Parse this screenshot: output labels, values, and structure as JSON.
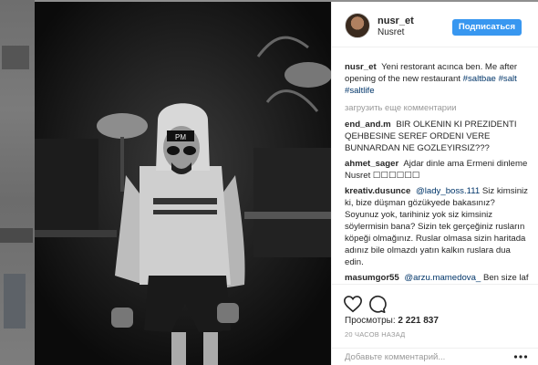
{
  "post": {
    "username": "nusr_et",
    "full_name": "Nusret",
    "follow_label": "Подписаться",
    "caption_user": "nusr_et",
    "caption_text": "Yeni restorant acınca ben. Me after opening of the new restaurant",
    "caption_tags": [
      "#saltbae",
      "#salt",
      "#saltlife"
    ]
  },
  "load_more_label": "загрузить еще комментарии",
  "comments": [
    {
      "user": "end_and.m",
      "text": "BIR OLKENIN KI PREZIDENTI QEHBESINE SEREF ORDENI VERE BUNNARDAN NE GOZLEYIRSIZ???"
    },
    {
      "user": "ahmet_sager",
      "text": "Ajdar dinle ama Ermeni dinleme Nusret ☐☐☐☐☐☐"
    },
    {
      "user": "kreativ.dusunce",
      "mention": "@lady_boss.111",
      "text": "Siz kimsiniz ki, bize düşman gözükyede bakasınız? Soyunuz yok, tarihiniz yok siz kimsiniz söylermisin bana? Sizin tek gerçeğiniz rusların köpeği olmağınız. Ruslar olmasa sizin haritada adınız bile olmazdı yatın kalkın ruslara dua edin."
    },
    {
      "user": "masumgor55",
      "mention": "@arzu.mamedova_",
      "text": "Ben size laf etmedim"
    }
  ],
  "stats": {
    "views_label": "Просмотры:",
    "views_value": "2 221 837",
    "time_ago": "20 ЧАСОВ НАЗАД"
  },
  "add_comment": {
    "placeholder": "Добавьте комментарий..."
  },
  "icons": [
    "heart-icon",
    "comment-icon",
    "more-options-icon"
  ],
  "colors": {
    "accent": "#3897f0",
    "hashtag": "#003569",
    "muted": "#999999"
  }
}
